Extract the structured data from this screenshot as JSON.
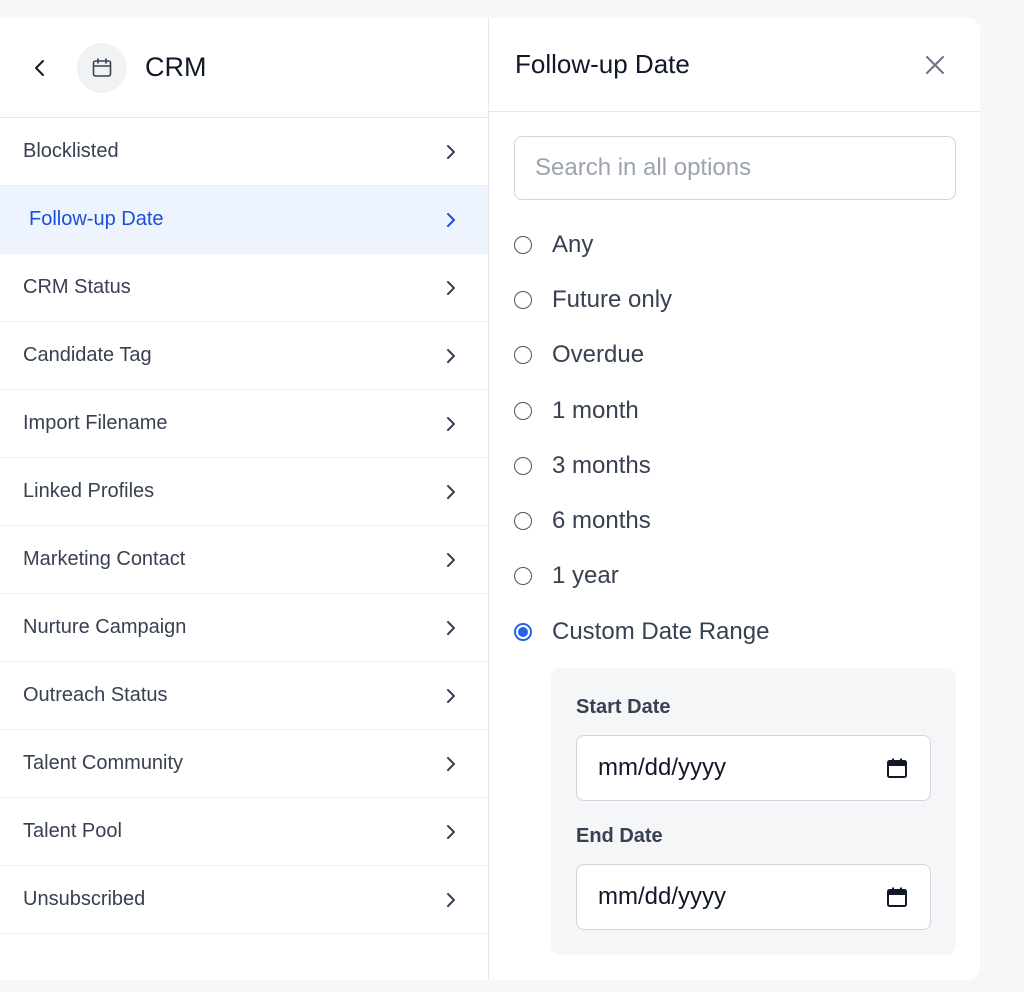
{
  "sidebar": {
    "title": "CRM",
    "items": [
      {
        "label": "Blocklisted"
      },
      {
        "label": "Follow-up Date",
        "active": true
      },
      {
        "label": "CRM Status"
      },
      {
        "label": "Candidate Tag"
      },
      {
        "label": "Import Filename"
      },
      {
        "label": "Linked Profiles"
      },
      {
        "label": "Marketing Contact"
      },
      {
        "label": "Nurture Campaign"
      },
      {
        "label": "Outreach Status"
      },
      {
        "label": "Talent Community"
      },
      {
        "label": "Talent Pool"
      },
      {
        "label": "Unsubscribed"
      }
    ]
  },
  "panel": {
    "title": "Follow-up Date",
    "search_placeholder": "Search in all options",
    "options": [
      {
        "label": "Any"
      },
      {
        "label": "Future only"
      },
      {
        "label": "Overdue"
      },
      {
        "label": "1 month"
      },
      {
        "label": "3 months"
      },
      {
        "label": "6 months"
      },
      {
        "label": "1 year"
      },
      {
        "label": "Custom Date Range",
        "selected": true
      }
    ],
    "custom": {
      "start_label": "Start Date",
      "start_value": "mm/dd/yyyy",
      "end_label": "End Date",
      "end_value": "mm/dd/yyyy"
    }
  },
  "colors": {
    "accent": "#2563eb",
    "active_bg": "#eef4fe"
  },
  "icons": {
    "back": "chevron-left-icon",
    "category": "calendar-icon",
    "item_arrow": "chevron-right-icon",
    "close": "close-icon",
    "date_picker": "calendar-icon"
  }
}
